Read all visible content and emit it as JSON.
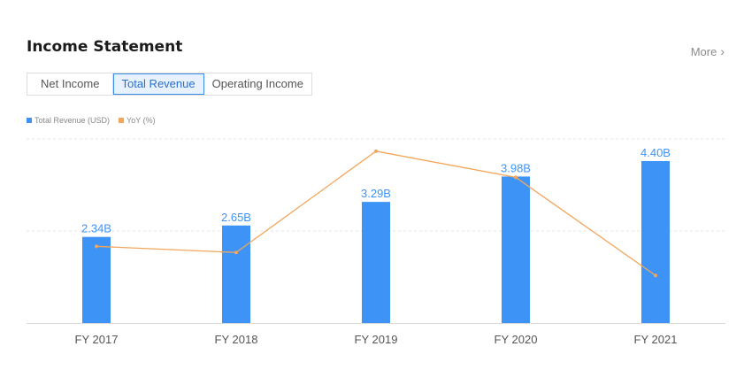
{
  "header": {
    "title": "Income Statement",
    "more_label": "More"
  },
  "tabs": [
    {
      "label": "Net Income",
      "active": false
    },
    {
      "label": "Total Revenue",
      "active": true
    },
    {
      "label": "Operating Income",
      "active": false
    }
  ],
  "legend": [
    {
      "label": "Total Revenue (USD)",
      "color": "#3d94f6"
    },
    {
      "label": "YoY (%)",
      "color": "#f2a65a"
    }
  ],
  "chart_data": {
    "type": "bar",
    "categories": [
      "FY 2017",
      "FY 2018",
      "FY 2019",
      "FY 2020",
      "FY 2021"
    ],
    "series": [
      {
        "name": "Total Revenue (USD)",
        "type": "bar",
        "values": [
          2.34,
          2.65,
          3.29,
          3.98,
          4.4
        ],
        "labels": [
          "2.34B",
          "2.65B",
          "3.29B",
          "3.98B",
          "4.40B"
        ],
        "color": "#3d94f6"
      },
      {
        "name": "YoY (%)",
        "type": "line",
        "values": [
          30,
          26,
          92,
          75,
          11
        ],
        "color": "#f2a65a"
      }
    ],
    "ylim": [
      0,
      5
    ],
    "yoy_ylim": [
      -20,
      100
    ],
    "grid": true,
    "legend_position": "top-left"
  }
}
